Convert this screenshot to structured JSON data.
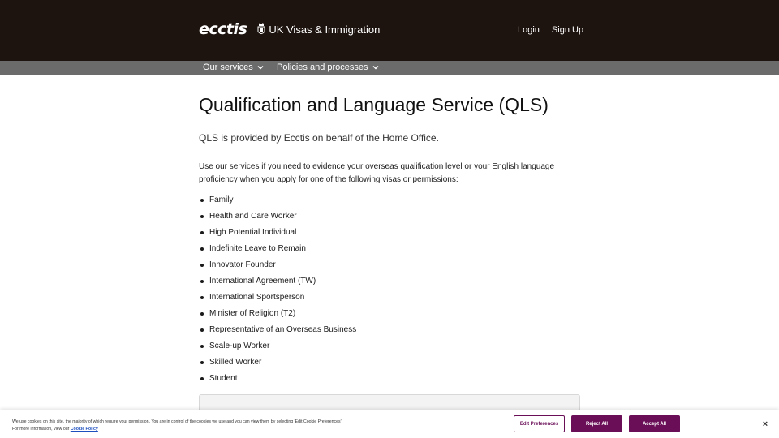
{
  "header": {
    "brand_logo": "ecctis",
    "brand_subtitle": "UK Visas & Immigration",
    "login_label": "Login",
    "signup_label": "Sign Up",
    "background_color": "#1e140f"
  },
  "navbar": {
    "items": [
      {
        "label": "Our services"
      },
      {
        "label": "Policies and processes"
      }
    ]
  },
  "main": {
    "title": "Qualification and Language Service (QLS)",
    "lead": "QLS is provided by Ecctis on behalf of the Home Office.",
    "intro": "Use our services if you need to evidence your overseas qualification level or your English language proficiency when you apply for one of the following visas or permissions:",
    "visas": [
      "Family",
      "Health and Care Worker",
      "High Potential Individual",
      "Indefinite Leave to Remain",
      "Innovator Founder",
      "International Agreement (TW)",
      "International Sportsperson",
      "Minister of Religion (T2)",
      "Representative of an Overseas Business",
      "Scale-up Worker",
      "Skilled Worker",
      "Student"
    ]
  },
  "cookie_banner": {
    "text_line1": "We use cookies on this site, the majority of which require your permission. You are in control of the cookies we use and you can view them by selecting 'Edit Cookie Preferences'.",
    "text_line2_prefix": "For more information, view our",
    "policy_link": "Cookie Policy",
    "edit_label": "Edit Preferences",
    "reject_label": "Reject All",
    "accept_label": "Accept All",
    "close_label": "×",
    "accent_color": "#6a0f57"
  }
}
